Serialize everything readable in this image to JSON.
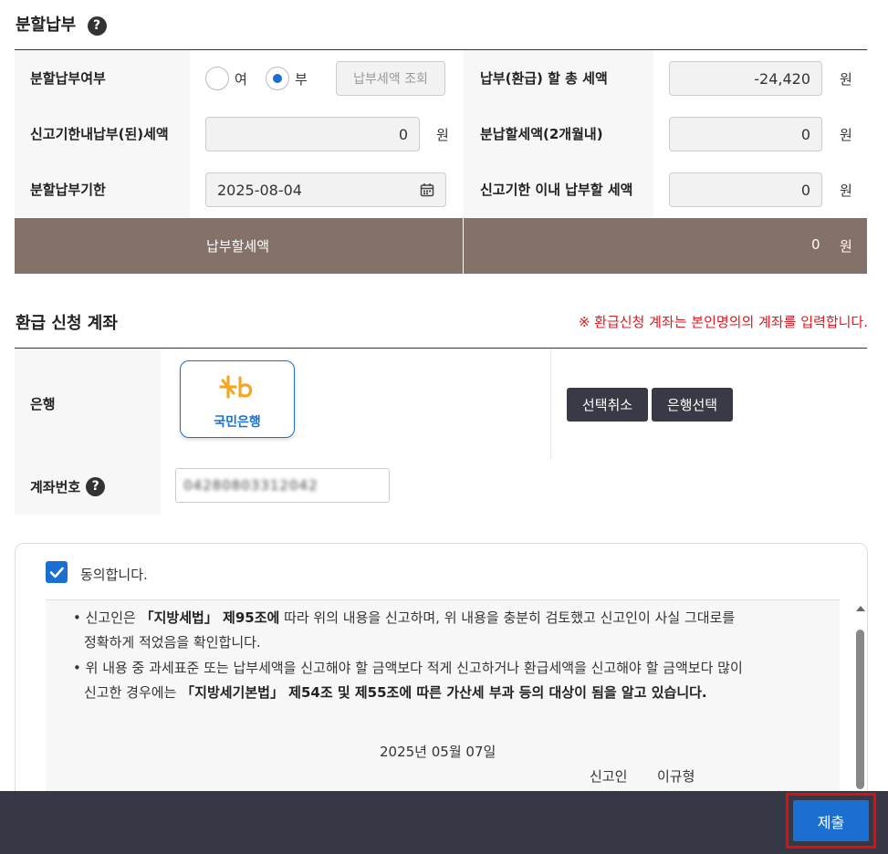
{
  "installment": {
    "title": "분할납부",
    "help": "?",
    "rows": {
      "option_label": "분할납부여부",
      "radio_yes": "여",
      "radio_no": "부",
      "lookup_button": "납부세액 조회",
      "total_label": "납부(환급) 할 총 세액",
      "total_value": "-24,420",
      "deadline_paid_label": "신고기한내납부(된)세액",
      "deadline_paid_value": "0",
      "split_label": "분납할세액(2개월내)",
      "split_value": "0",
      "due_label": "분할납부기한",
      "due_value": "2025-08-04",
      "within_label": "신고기한 이내 납부할 세액",
      "within_value": "0",
      "unit": "원"
    },
    "summary_label": "납부할세액",
    "summary_value": "0",
    "summary_unit": "원"
  },
  "refund": {
    "title": "환급 신청 계좌",
    "notice": "※ 환급신청 계좌는 본인명의의 계좌를 입력합니다.",
    "bank_label": "은행",
    "bank_name": "국민은행",
    "bank_logo": "Kb",
    "cancel_button": "선택취소",
    "select_button": "은행선택",
    "account_label": "계좌번호",
    "account_help": "?",
    "account_value": "04280803312042"
  },
  "agreement": {
    "checkbox_label": "동의합니다.",
    "line1_pre": "신고인은 ",
    "line1_bold": "「지방세법」 제95조에",
    "line1_post": " 따라 위의 내용을 신고하며, 위 내용을 충분히 검토했고 신고인이 사실 그대로를",
    "line1b": "정확하게 적었음을 확인합니다.",
    "line2": "위 내용 중 과세표준 또는 납부세액을 신고해야 할 금액보다 적게 신고하거나 환급세액을 신고해야 할 금액보다 많이",
    "line2b_pre": "신고한 경우에는 ",
    "line2b_bold": "「지방세기본법」 제54조 및 제55조에 따른 가산세 부과 등의 대상이 됨을 알고 있습니다.",
    "date": "2025년 05월 07일",
    "declarant_label": "신고인",
    "declarant_name": "이규형"
  },
  "footer": {
    "submit": "제출"
  },
  "colors": {
    "accent": "#1a6fd1",
    "summary_bg": "#84726a",
    "footer_bg": "#363845",
    "notice": "#e3181e",
    "highlight": "#e30d0d"
  }
}
